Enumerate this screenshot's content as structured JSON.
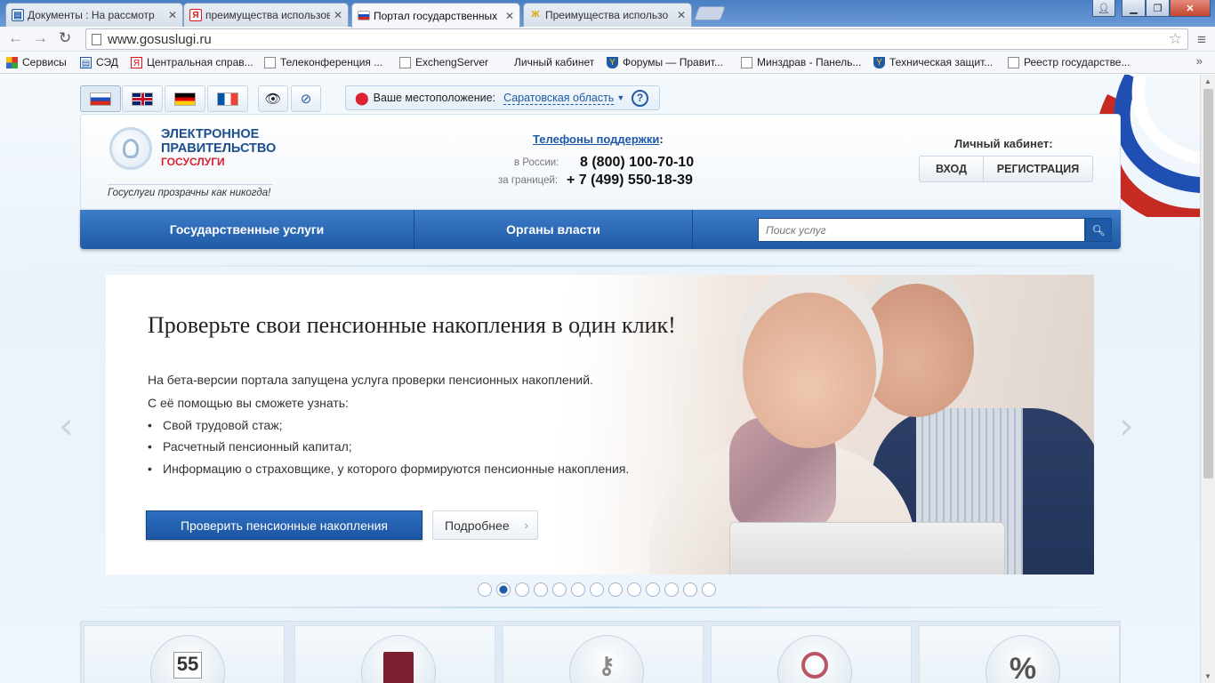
{
  "browser": {
    "tabs": [
      {
        "title": "Документы : На рассмотр",
        "favicon_color": "#1f5aa6",
        "favicon_glyph": "▤"
      },
      {
        "title": "преимущества использов",
        "favicon_color": "#d11",
        "favicon_glyph": "Я"
      },
      {
        "title": "Портал государственных",
        "favicon_color": "#1f5aa6",
        "favicon_glyph": "flag-ru"
      },
      {
        "title": "Преимущества использо",
        "favicon_color": "#e0a000",
        "favicon_glyph": "Ж"
      }
    ],
    "active_tab": 2,
    "url": "www.gosuslugi.ru",
    "bookmarks": [
      {
        "label": "Сервисы",
        "icon": "apps-grid-icon"
      },
      {
        "label": "СЭД",
        "icon": "doc-icon"
      },
      {
        "label": "Центральная справ...",
        "icon": "yandex-icon"
      },
      {
        "label": "Телеконференция ...",
        "icon": "page-icon"
      },
      {
        "label": "ExchengServer",
        "icon": "page-icon"
      },
      {
        "label": "Личный кабинет",
        "icon": "none"
      },
      {
        "label": "Форумы — Правит...",
        "icon": "shield-icon"
      },
      {
        "label": "Минздрав - Панель...",
        "icon": "page-icon"
      },
      {
        "label": "Техническая защит...",
        "icon": "shield-icon"
      },
      {
        "label": "Реестр государстве...",
        "icon": "page-icon"
      }
    ],
    "bookmarks_more": "»"
  },
  "site": {
    "languages": [
      {
        "code": "ru",
        "name": "Русский",
        "selected": true
      },
      {
        "code": "en",
        "name": "English",
        "selected": false
      },
      {
        "code": "de",
        "name": "Deutsch",
        "selected": false
      },
      {
        "code": "fr",
        "name": "Français",
        "selected": false
      }
    ],
    "location": {
      "label": "Ваше местоположение:",
      "value": "Саратовская область",
      "help": "?"
    },
    "logo": {
      "line1": "ЭЛЕКТРОННОЕ",
      "line2": "ПРАВИТЕЛЬСТВО",
      "line3": "ГОСУСЛУГИ",
      "slogan": "Госуслуги прозрачны как никогда!"
    },
    "support": {
      "title": "Телефоны поддержки",
      "colon": ":",
      "russia_label": "в России:",
      "russia_number": "8 (800) 100-70-10",
      "abroad_label": "за границей:",
      "abroad_number": "+ 7 (499) 550-18-39"
    },
    "cabinet": {
      "title": "Личный кабинет:",
      "login": "ВХОД",
      "register": "РЕГИСТРАЦИЯ"
    },
    "nav": {
      "services": "Государственные услуги",
      "authorities": "Органы власти"
    },
    "search": {
      "placeholder": "Поиск услуг"
    },
    "slide": {
      "title": "Проверьте свои пенсионные накопления в один клик!",
      "p1": "На бета-версии портала запущена услуга проверки пенсионных накоплений.",
      "p2": "С её помощью вы сможете узнать:",
      "bullets": [
        "Свой трудовой стаж;",
        "Расчетный пенсионный капитал;",
        "Информацию о страховщике, у которого формируются пенсионные накопления."
      ],
      "primary_button": "Проверить пенсионные накопления",
      "secondary_button": "Подробнее"
    },
    "carousel": {
      "count": 13,
      "active": 1
    },
    "categories": [
      "calendar-55",
      "passport",
      "keys",
      "family",
      "percent"
    ],
    "category_glyphs": {
      "calendar": "55",
      "percent": "%"
    },
    "colors": {
      "brand_blue": "#1f5aa6",
      "brand_red": "#d8202e"
    }
  }
}
